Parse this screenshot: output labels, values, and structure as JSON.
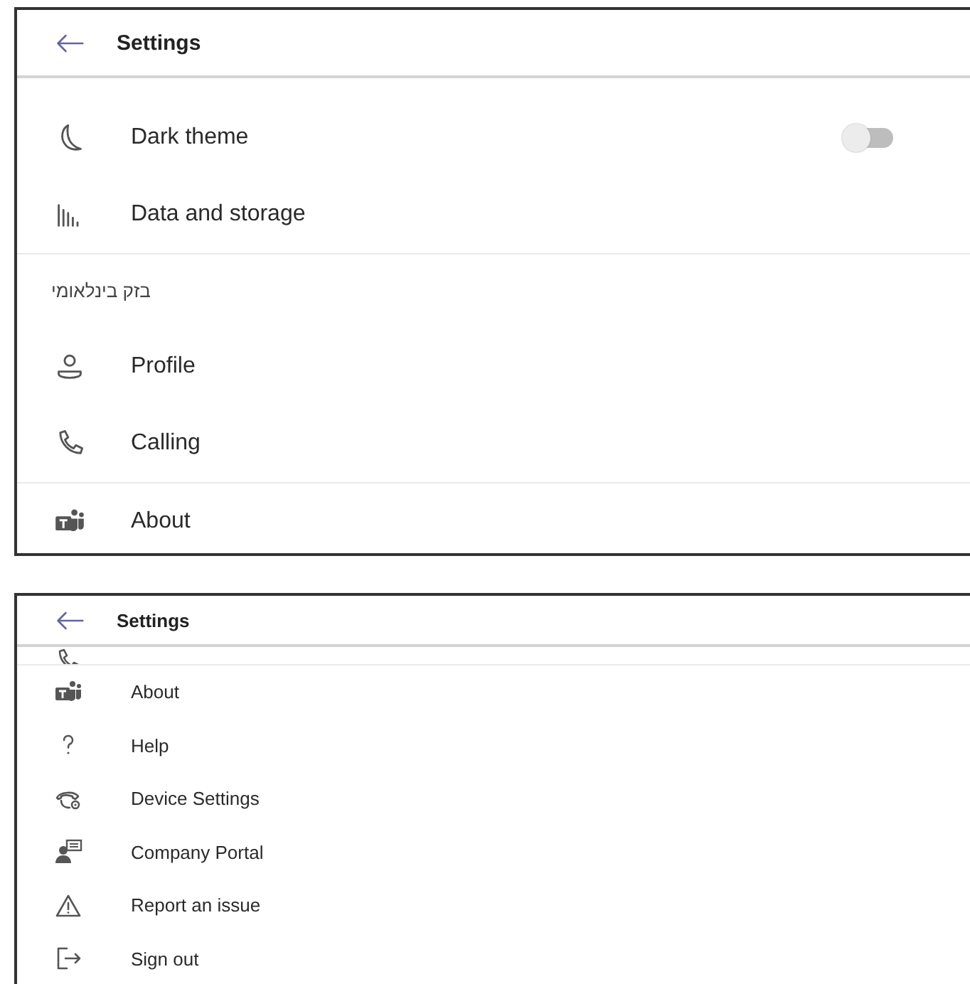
{
  "panels": [
    {
      "header": {
        "title": "Settings"
      },
      "items": [
        {
          "kind": "toggle",
          "label": "Dark theme",
          "on": false
        },
        {
          "kind": "link",
          "label": "Data and storage"
        },
        {
          "kind": "divider"
        },
        {
          "kind": "section",
          "label": "בזק בינלאומי"
        },
        {
          "kind": "link",
          "label": "Profile"
        },
        {
          "kind": "link",
          "label": "Calling"
        },
        {
          "kind": "divider"
        },
        {
          "kind": "link",
          "label": "About"
        }
      ]
    },
    {
      "header": {
        "title": "Settings"
      },
      "items": [
        {
          "kind": "clipped"
        },
        {
          "kind": "divider"
        },
        {
          "kind": "link",
          "label": "About"
        },
        {
          "kind": "link",
          "label": "Help"
        },
        {
          "kind": "link",
          "label": "Device Settings"
        },
        {
          "kind": "link",
          "label": "Company Portal"
        },
        {
          "kind": "link",
          "label": "Report an issue"
        },
        {
          "kind": "link",
          "label": "Sign out"
        }
      ]
    }
  ]
}
